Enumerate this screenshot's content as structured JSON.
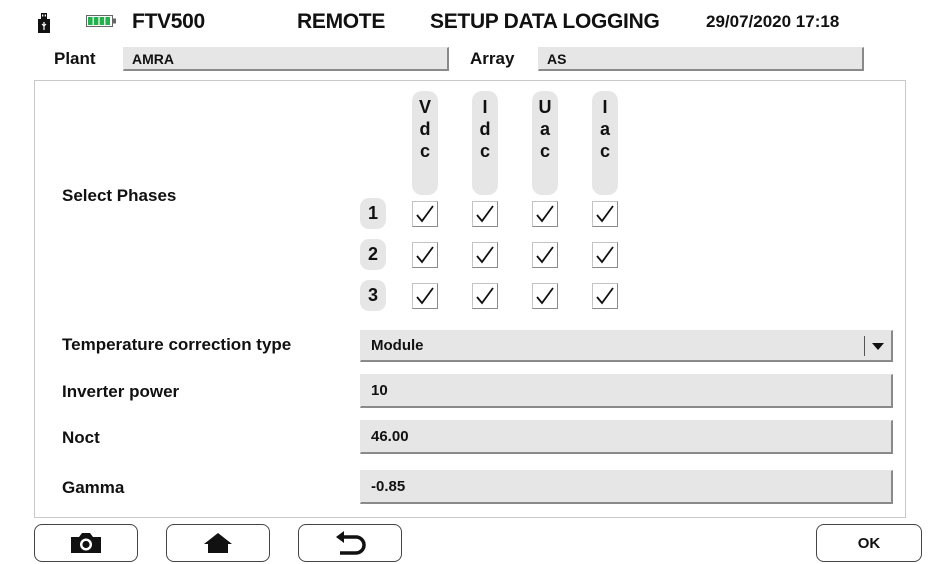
{
  "header": {
    "device": "FTV500",
    "mode": "REMOTE",
    "screen": "SETUP DATA LOGGING",
    "datetime": "29/07/2020 17:18"
  },
  "plant": {
    "label": "Plant",
    "value": "AMRA"
  },
  "array": {
    "label": "Array",
    "value": "AS"
  },
  "phases": {
    "label": "Select Phases",
    "columns": [
      {
        "letters": [
          "V",
          "d",
          "c"
        ]
      },
      {
        "letters": [
          "I",
          "d",
          "c"
        ]
      },
      {
        "letters": [
          "U",
          "a",
          "c"
        ]
      },
      {
        "letters": [
          "I",
          "a",
          "c"
        ]
      }
    ],
    "rows": [
      "1",
      "2",
      "3"
    ],
    "checked": [
      [
        true,
        true,
        true,
        true
      ],
      [
        true,
        true,
        true,
        true
      ],
      [
        true,
        true,
        true,
        true
      ]
    ]
  },
  "fields": {
    "temp_correction": {
      "label": "Temperature correction type",
      "value": "Module"
    },
    "inverter_power": {
      "label": "Inverter power",
      "value": "10"
    },
    "noct": {
      "label": "Noct",
      "value": "46.00"
    },
    "gamma": {
      "label": "Gamma",
      "value": "-0.85"
    }
  },
  "buttons": {
    "ok": "OK"
  },
  "icons": {
    "usb": "usb-icon",
    "battery": "battery-icon",
    "camera": "camera-icon",
    "home": "home-icon",
    "back": "back-arrow-icon",
    "dropdown": "dropdown-arrow-icon"
  },
  "colors": {
    "battery_green": "#22b14c",
    "field_bg": "#e6e6e6"
  }
}
